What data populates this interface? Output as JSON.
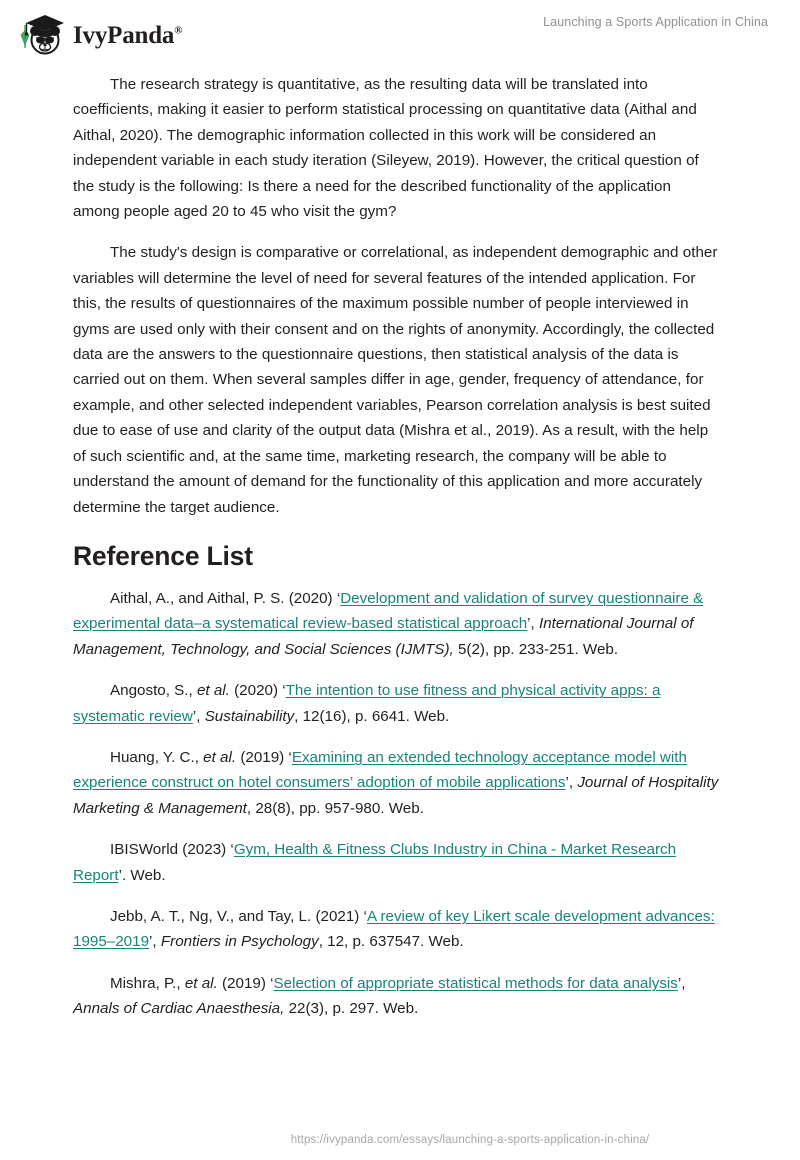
{
  "header": {
    "brand_name": "IvyPanda",
    "brand_registered_mark": "®",
    "logo_icon": "panda-graduate-logo",
    "document_title": "Launching a Sports Application in China"
  },
  "body": {
    "paragraphs": [
      {
        "id": "research-strategy",
        "text": "The research strategy is quantitative, as the resulting data will be translated into coefficients, making it easier to perform statistical processing on quantitative data (Aithal and Aithal, 2020). The demographic information collected in this work will be considered an independent variable in each study iteration (Sileyew, 2019). However, the critical question of the study is the following: Is there a need for the described functionality of the application among people aged 20 to 45 who visit the gym?"
      },
      {
        "id": "study-design",
        "text": "The study's design is comparative or correlational, as independent demographic and other variables will determine the level of need for several features of the intended application. For this, the results of questionnaires of the maximum possible number of people interviewed in gyms are used only with their consent and on the rights of anonymity. Accordingly, the collected data are the answers to the questionnaire questions, then statistical analysis of the data is carried out on them. When several samples differ in age, gender, frequency of attendance, for example, and other selected independent variables, Pearson correlation analysis is best suited due to ease of use and clarity of the output data (Mishra et al., 2019). As a result, with the help of such scientific and, at the same time, marketing research, the company will be able to understand the amount of demand for the functionality of this application and more accurately determine the target audience."
      }
    ]
  },
  "reference_section": {
    "heading": "Reference List",
    "link_color": "#17847b",
    "entries": [
      {
        "id": "aithal-2020",
        "prefix": "Aithal, A., and Aithal, P. S. (2020) ‘",
        "link": "Development and validation of survey questionnaire & experimental data–a systematical review-based statistical approach",
        "after_link": "’, ",
        "italic": "International Journal of Management, Technology, and Social Sciences (IJMTS),",
        "suffix": " 5(2), pp. 233-251. Web."
      },
      {
        "id": "angosto-2020",
        "prefix": "Angosto, S., ",
        "italic_inline": "et al.",
        "mid": " (2020) ‘",
        "link": "The intention to use fitness and physical activity apps: a systematic review",
        "after_link": "’, ",
        "italic": "Sustainability",
        "suffix": ", 12(16), p. 6641. Web."
      },
      {
        "id": "huang-2019",
        "prefix": "Huang, Y. C., ",
        "italic_inline": "et al.",
        "mid": " (2019) ‘",
        "link": "Examining an extended technology acceptance model with experience construct on hotel consumers’ adoption of mobile applications",
        "after_link": "’, ",
        "italic": "Journal of Hospitality Marketing & Management",
        "suffix": ", 28(8), pp. 957-980. Web."
      },
      {
        "id": "ibisworld-2023",
        "prefix": "IBISWorld (2023) ‘",
        "link": "Gym, Health & Fitness Clubs Industry in China - Market Research Report",
        "after_link": "’. Web.",
        "italic": "",
        "suffix": ""
      },
      {
        "id": "jebb-2021",
        "prefix": "Jebb, A. T., Ng, V., and Tay, L. (2021) ‘",
        "link": "A review of key Likert scale development advances: 1995–2019",
        "after_link": "’, ",
        "italic": "Frontiers in Psychology",
        "suffix": ", 12, p. 637547. Web."
      },
      {
        "id": "mishra-2019",
        "prefix": "Mishra, P., ",
        "italic_inline": "et al.",
        "mid": " (2019) ‘",
        "link": "Selection of appropriate statistical methods for data analysis",
        "after_link": "’, ",
        "italic": "Annals of Cardiac Anaesthesia,",
        "suffix": " 22(3), p. 297. Web."
      }
    ]
  },
  "footer": {
    "url": "https://ivypanda.com/essays/launching-a-sports-application-in-china/"
  }
}
